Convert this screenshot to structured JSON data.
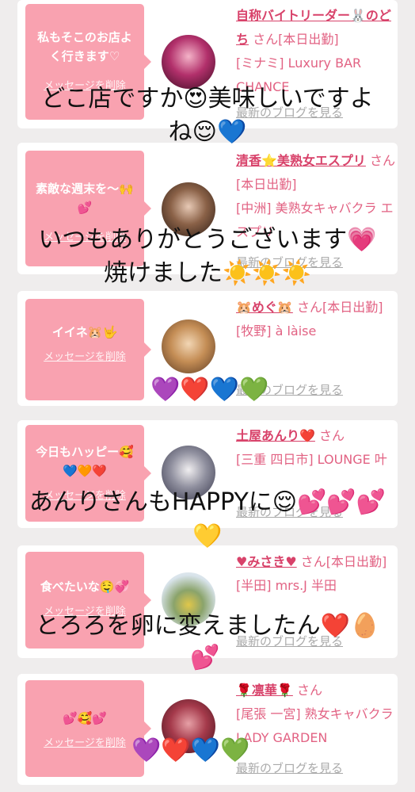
{
  "cards": [
    {
      "message": "私もそこのお店よく行きます♡",
      "delete_label": "メッセージを削除",
      "name": "自称バイトリーダー🐰のどち",
      "san": "さん[本日出勤]",
      "shop": "[ミナミ] Luxury BAR CHANCE",
      "blog": "最新のブログを見る"
    },
    {
      "message": "素敵な週末を〜🙌💕",
      "delete_label": "メッセージを削除",
      "name": "清香⭐美熟女エスプリ",
      "san": "さん[本日出勤]",
      "shop": "[中洲] 美熟女キャバクラ エスプリ",
      "blog": "最新のブログを見る"
    },
    {
      "message": "イイネ🐹🤟",
      "delete_label": "メッセージを削除",
      "name": "🐹めぐ🐹",
      "san": "さん[本日出勤]",
      "shop": "[牧野] à làise",
      "blog": "最新のブログを見る"
    },
    {
      "message": "今日もハッピー🥰💙🧡❤️",
      "delete_label": "メッセージを削除",
      "name": "土屋あんり❤️",
      "san": "さん",
      "shop": "[三重 四日市] LOUNGE 叶",
      "blog": "最新のブログを見る"
    },
    {
      "message": "食べたいな🤤💞",
      "delete_label": "メッセージを削除",
      "name": "♥みさき♥",
      "san": "さん[本日出勤]",
      "shop": "[半田] mrs.J 半田",
      "blog": "最新のブログを見る"
    },
    {
      "message": "💕🥰💕",
      "delete_label": "メッセージを削除",
      "name": "🌹凛華🌹",
      "san": "さん",
      "shop": "[尾張 一宮] 熟女キャバクラ LADY GARDEN",
      "blog": "最新のブログを見る"
    }
  ],
  "overlays": {
    "o1_line1": "どこ店ですか😍美味しいですよ",
    "o1_line2": "ね😌💙",
    "o2_line1": "いつもありがとうございます💗",
    "o2_line2": "焼けました☀️☀️☀️",
    "hearts3": "💜❤️💙💚",
    "o4_line1": "あんりさんもHAPPYに😌💕💕💕",
    "o4_line2": "💛",
    "o5_line1": "とろろを卵に変えましたん❤️🥚",
    "o5_line2": "💕",
    "hearts6": "💜❤️💙💚"
  },
  "colors": {
    "bubble": "#f9a2b0",
    "name": "#d8426a",
    "shop": "#e26283",
    "background": "#efeded"
  }
}
